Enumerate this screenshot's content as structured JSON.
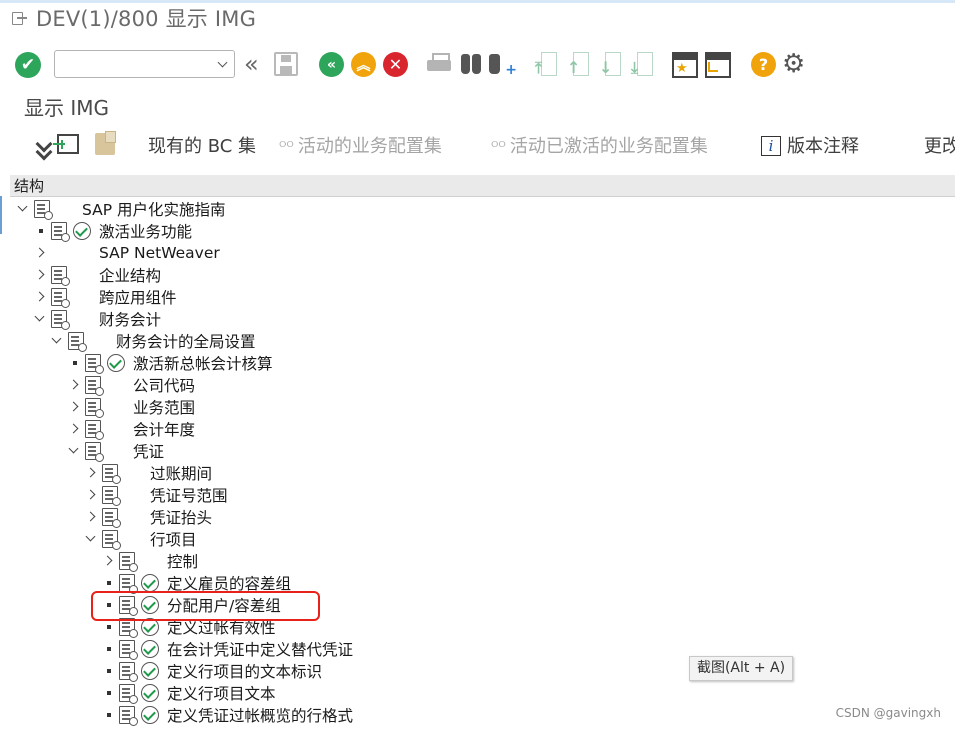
{
  "window": {
    "title": "DEV(1)/800 显示 IMG"
  },
  "toolbar": {
    "command_field_placeholder": "",
    "icons": [
      "enter-icon",
      "history-back-icon",
      "save-icon",
      "back-icon",
      "exit-icon",
      "cancel-icon",
      "print-icon",
      "find-icon",
      "find-next-icon",
      "first-page-icon",
      "previous-page-icon",
      "next-page-icon",
      "last-page-icon",
      "create-session-icon",
      "shortcut-icon",
      "help-icon",
      "settings-icon"
    ]
  },
  "screen": {
    "title": "显示 IMG"
  },
  "app_toolbar": {
    "existing_bc_sets": "现有的 BC 集",
    "active_biz_config_sets": "活动的业务配置集",
    "activated_biz_config_sets": "活动已激活的业务配置集",
    "release_notes": "版本注释",
    "more": "更改"
  },
  "tree": {
    "header": "结构",
    "nodes": [
      {
        "label": "SAP 用户化实施指南",
        "expander": "down"
      },
      {
        "label": "激活业务功能",
        "expander": "bullet",
        "activity": true
      },
      {
        "label": "SAP NetWeaver",
        "expander": "right"
      },
      {
        "label": "企业结构",
        "expander": "right"
      },
      {
        "label": "跨应用组件",
        "expander": "right"
      },
      {
        "label": "财务会计",
        "expander": "down"
      },
      {
        "label": "财务会计的全局设置",
        "expander": "down"
      },
      {
        "label": "激活新总帐会计核算",
        "expander": "bullet",
        "activity": true
      },
      {
        "label": "公司代码",
        "expander": "right"
      },
      {
        "label": "业务范围",
        "expander": "right"
      },
      {
        "label": "会计年度",
        "expander": "right"
      },
      {
        "label": "凭证",
        "expander": "down"
      },
      {
        "label": "过账期间",
        "expander": "right"
      },
      {
        "label": "凭证号范围",
        "expander": "right"
      },
      {
        "label": "凭证抬头",
        "expander": "right"
      },
      {
        "label": "行项目",
        "expander": "down"
      },
      {
        "label": "控制",
        "expander": "right"
      },
      {
        "label": "定义雇员的容差组",
        "expander": "bullet",
        "activity": true
      },
      {
        "label": "分配用户/容差组",
        "expander": "bullet",
        "activity": true
      },
      {
        "label": "定义过帐有效性",
        "expander": "bullet",
        "activity": true
      },
      {
        "label": "在会计凭证中定义替代凭证",
        "expander": "bullet",
        "activity": true
      },
      {
        "label": "定义行项目的文本标识",
        "expander": "bullet",
        "activity": true
      },
      {
        "label": "定义行项目文本",
        "expander": "bullet",
        "activity": true
      },
      {
        "label": "定义凭证过帐概览的行格式",
        "expander": "bullet",
        "activity": true
      }
    ]
  },
  "tooltip": {
    "text": "截图(Alt + A)"
  },
  "watermark": {
    "text": "CSDN @gavingxh"
  },
  "colors": {
    "green": "#2da55a",
    "orange": "#f0a30a",
    "red": "#d9252e",
    "highlight": "#e8211b"
  }
}
